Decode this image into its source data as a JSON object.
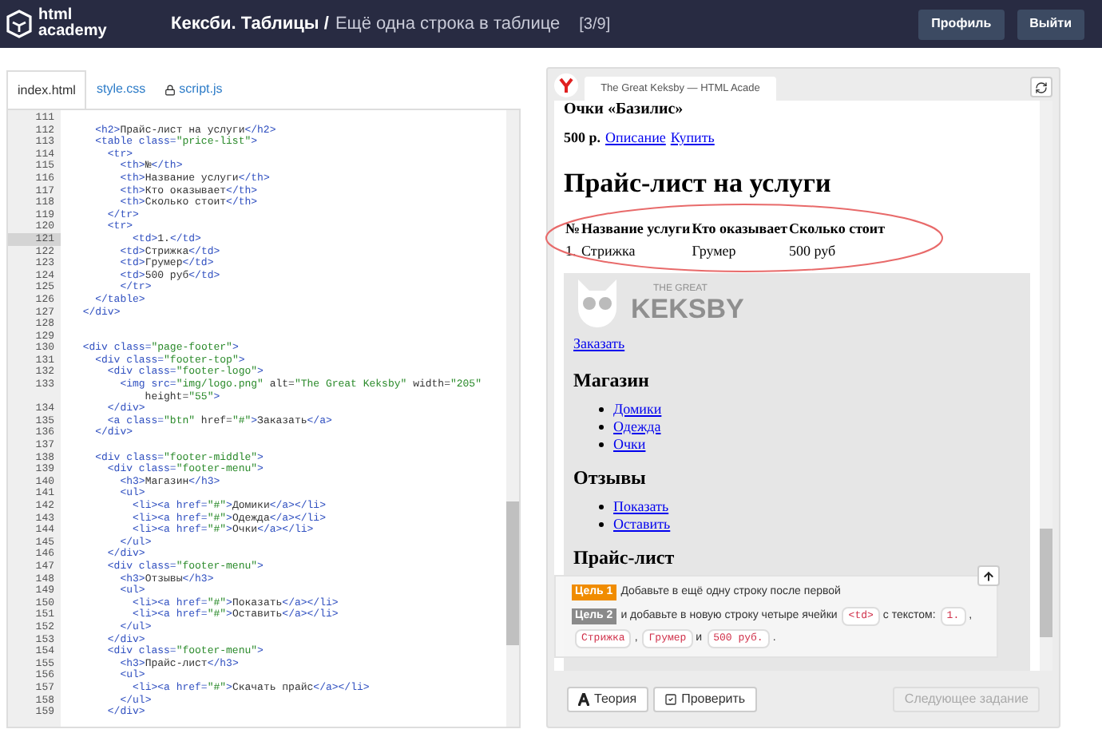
{
  "header": {
    "logo": [
      "html",
      "academy"
    ],
    "course": "Кексби. Таблицы /",
    "lesson": "Ещё одна строка в таблице",
    "progress": "[3/9]",
    "buttons": [
      "Профиль",
      "Выйти"
    ]
  },
  "editor": {
    "tabs": [
      {
        "label": "index.html",
        "selected": true,
        "locked": false
      },
      {
        "label": "style.css",
        "selected": false,
        "locked": false
      },
      {
        "label": "script.js",
        "selected": false,
        "locked": true
      }
    ],
    "lines": [
      {
        "n": "111",
        "active": false
      },
      {
        "n": "112",
        "code": "    <h2>Прайс-лист на услуги</h2>",
        "active": false
      },
      {
        "n": "113",
        "code": "    <table class=\"price-list\">",
        "active": false
      },
      {
        "n": "114",
        "code": "      <tr>",
        "active": false
      },
      {
        "n": "115",
        "code": "        <th>№</th>",
        "active": false
      },
      {
        "n": "116",
        "code": "        <th>Название услуги</th>",
        "active": false
      },
      {
        "n": "117",
        "code": "        <th>Кто оказывает</th>",
        "active": false
      },
      {
        "n": "118",
        "code": "        <th>Сколько стоит</th>",
        "active": false
      },
      {
        "n": "119",
        "code": "      </tr>",
        "active": false
      },
      {
        "n": "120",
        "code": "      <tr>",
        "active": false
      },
      {
        "n": "121",
        "code": "          <td>1.</td>",
        "active": true
      },
      {
        "n": "122",
        "code": "        <td>Стрижка</td>",
        "active": false
      },
      {
        "n": "123",
        "code": "        <td>Грумер</td>",
        "active": false
      },
      {
        "n": "124",
        "code": "        <td>500 руб</td>",
        "active": false
      },
      {
        "n": "125",
        "code": "        </tr>",
        "active": false
      },
      {
        "n": "126",
        "code": "    </table>",
        "active": false
      },
      {
        "n": "127",
        "code": "  </div>",
        "active": false
      },
      {
        "n": "128",
        "active": false
      },
      {
        "n": "129",
        "active": false
      },
      {
        "n": "130",
        "code": "  <div class=\"page-footer\">",
        "active": false
      },
      {
        "n": "131",
        "code": "    <div class=\"footer-top\">",
        "active": false
      },
      {
        "n": "132",
        "code": "      <div class=\"footer-logo\">",
        "active": false
      },
      {
        "n": "133",
        "code": "        <img src=\"img/logo.png\" alt=\"The Great Keksby\" width=\"205\"",
        "wrap": "            height=\"55\">",
        "active": false
      },
      {
        "n": "134",
        "code": "      </div>",
        "active": false
      },
      {
        "n": "135",
        "code": "      <a class=\"btn\" href=\"#\">Заказать</a>",
        "active": false
      },
      {
        "n": "136",
        "code": "    </div>",
        "active": false
      },
      {
        "n": "137",
        "active": false
      },
      {
        "n": "138",
        "code": "    <div class=\"footer-middle\">",
        "active": false
      },
      {
        "n": "139",
        "code": "      <div class=\"footer-menu\">",
        "active": false
      },
      {
        "n": "140",
        "code": "        <h3>Магазин</h3>",
        "active": false
      },
      {
        "n": "141",
        "code": "        <ul>",
        "active": false
      },
      {
        "n": "142",
        "code": "          <li><a href=\"#\">Домики</a></li>",
        "active": false
      },
      {
        "n": "143",
        "code": "          <li><a href=\"#\">Одежда</a></li>",
        "active": false
      },
      {
        "n": "144",
        "code": "          <li><a href=\"#\">Очки</a></li>",
        "active": false
      },
      {
        "n": "145",
        "code": "        </ul>",
        "active": false
      },
      {
        "n": "146",
        "code": "      </div>",
        "active": false
      },
      {
        "n": "147",
        "code": "      <div class=\"footer-menu\">",
        "active": false
      },
      {
        "n": "148",
        "code": "        <h3>Отзывы</h3>",
        "active": false
      },
      {
        "n": "149",
        "code": "        <ul>",
        "active": false
      },
      {
        "n": "150",
        "code": "          <li><a href=\"#\">Показать</a></li>",
        "active": false
      },
      {
        "n": "151",
        "code": "          <li><a href=\"#\">Оставить</a></li>",
        "active": false
      },
      {
        "n": "152",
        "code": "        </ul>",
        "active": false
      },
      {
        "n": "153",
        "code": "      </div>",
        "active": false
      },
      {
        "n": "154",
        "code": "      <div class=\"footer-menu\">",
        "active": false
      },
      {
        "n": "155",
        "code": "        <h3>Прайс-лист</h3>",
        "active": false
      },
      {
        "n": "156",
        "code": "        <ul>",
        "active": false
      },
      {
        "n": "157",
        "code": "          <li><a href=\"#\">Скачать прайс</a></li>",
        "active": false
      },
      {
        "n": "158",
        "code": "        </ul>",
        "active": false
      },
      {
        "n": "159",
        "code": "      </div>",
        "active": false
      }
    ]
  },
  "preview": {
    "tab_title": "The Great Keksby — HTML Acade",
    "product_title": "Очки «Базилис»",
    "price": "500 р.",
    "links": [
      "Описание",
      "Купить"
    ],
    "heading": "Прайс-лист на услуги",
    "table": {
      "columns": [
        "№",
        "Название услуги",
        "Кто оказывает",
        "Сколько стоит"
      ],
      "rows": [
        [
          "1.",
          "Стрижка",
          "Грумер",
          "500 руб"
        ]
      ]
    },
    "footer": {
      "logo_small": "THE GREAT",
      "logo_big": "KEKSBY",
      "order_link": "Заказать",
      "menus": [
        {
          "title": "Магазин",
          "items": [
            "Домики",
            "Одежда",
            "Очки"
          ]
        },
        {
          "title": "Отзывы",
          "items": [
            "Показать",
            "Оставить"
          ]
        },
        {
          "title": "Прайс-лист"
        }
      ]
    }
  },
  "goals": [
    {
      "label": "Цель 1",
      "active": true,
      "parts": [
        {
          "kind": "text",
          "text": "Добавьте в ещё одну строку после первой"
        }
      ]
    },
    {
      "label": "Цель 2",
      "active": false,
      "parts": [
        {
          "kind": "text",
          "text": "и добавьте в новую строку четыре ячейки"
        },
        {
          "kind": "code",
          "text": "<td>"
        },
        {
          "kind": "text",
          "text": "с текстом:"
        },
        {
          "kind": "code",
          "text": "1."
        },
        {
          "kind": "text",
          "text": ","
        },
        {
          "kind": "code",
          "text": "Стрижка"
        },
        {
          "kind": "text",
          "text": ","
        },
        {
          "kind": "code",
          "text": "Грумер"
        },
        {
          "kind": "text",
          "text": "и"
        },
        {
          "kind": "code",
          "text": "500 руб."
        },
        {
          "kind": "text",
          "text": "."
        }
      ]
    }
  ],
  "actions": [
    {
      "label": "Теория",
      "kind": "theory",
      "disabled": false
    },
    {
      "label": "Проверить",
      "kind": "check",
      "disabled": false
    },
    {
      "label": "Следующее задание",
      "kind": "next",
      "disabled": true
    }
  ]
}
